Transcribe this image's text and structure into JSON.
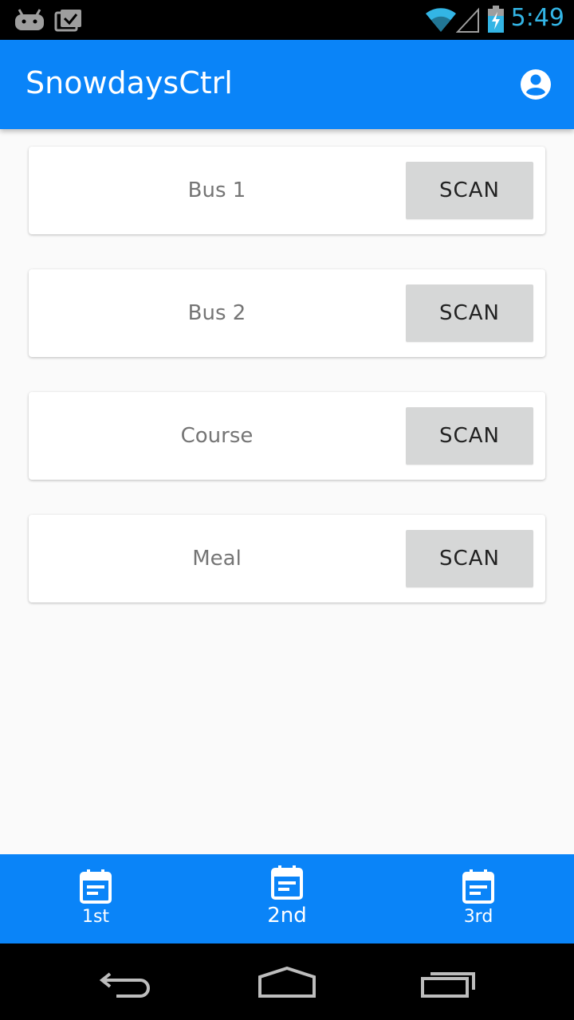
{
  "status_bar": {
    "time": "5:49",
    "icons": [
      "android-debug-icon",
      "clipboard-check-icon",
      "wifi-icon",
      "signal-icon",
      "battery-charging-icon"
    ],
    "time_color": "#33b5e5"
  },
  "app_bar": {
    "title": "SnowdaysCtrl",
    "account_icon": "account-circle-icon",
    "color": "#0a84f8"
  },
  "cards": [
    {
      "label": "Bus 1",
      "button": "SCAN"
    },
    {
      "label": "Bus 2",
      "button": "SCAN"
    },
    {
      "label": "Course",
      "button": "SCAN"
    },
    {
      "label": "Meal",
      "button": "SCAN"
    }
  ],
  "bottom_nav": {
    "tabs": [
      {
        "label": "1st",
        "icon": "event-note-icon"
      },
      {
        "label": "2nd",
        "icon": "event-note-icon",
        "selected": true
      },
      {
        "label": "3rd",
        "icon": "event-note-icon"
      }
    ]
  },
  "system_nav": {
    "buttons": [
      "back-icon",
      "home-icon",
      "recents-icon"
    ]
  }
}
